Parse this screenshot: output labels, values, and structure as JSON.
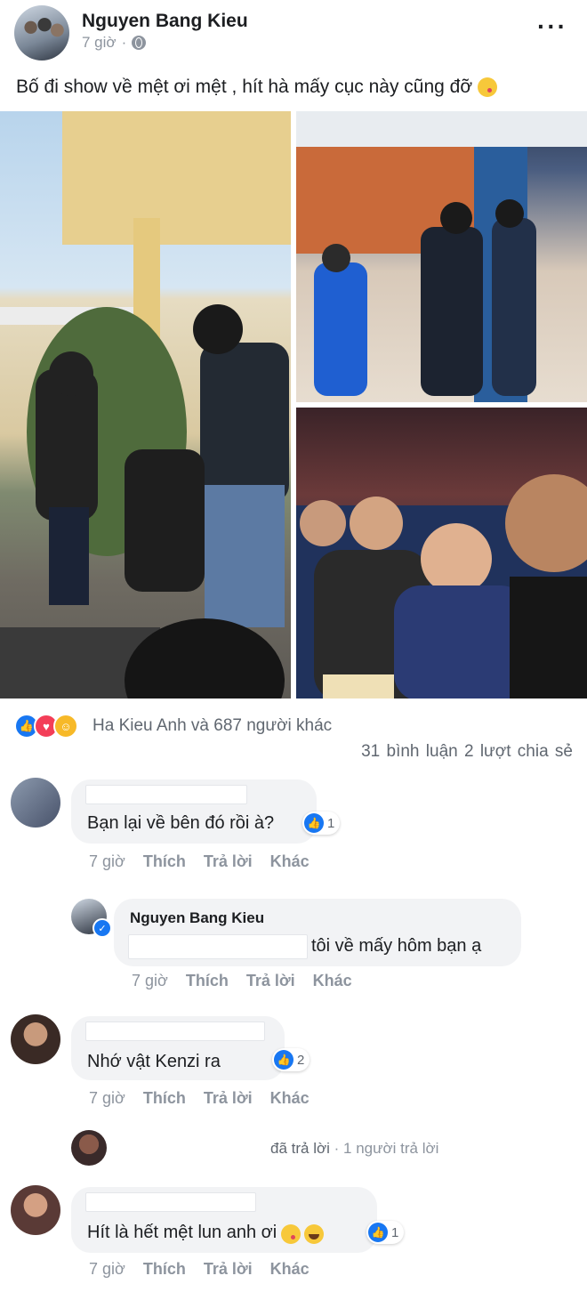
{
  "post": {
    "author": "Nguyen Bang Kieu",
    "time": "7 giờ",
    "caption": "Bố đi show về mệt ơi mệt , hít hà mấy cục này cũng đỡ",
    "more_icon": "ellipsis-icon",
    "privacy_icon": "globe-icon"
  },
  "reactions": {
    "summary": "Ha Kieu Anh và 687 người khác",
    "comments_count": "31 bình luận",
    "shares_count": "2 lượt chia sẻ",
    "icons": [
      "like-icon",
      "love-icon",
      "haha-icon"
    ]
  },
  "actions": {
    "time": "7 giờ",
    "like": "Thích",
    "reply": "Trả lời",
    "more": "Khác"
  },
  "comments": [
    {
      "text": "Bạn lại về bên đó rồi à?",
      "likes": "1"
    },
    {
      "author": "Nguyen Bang Kieu",
      "text": "tôi về mấy hôm bạn ạ"
    },
    {
      "text": "Nhớ vật Kenzi ra",
      "likes": "2"
    },
    {
      "replied": "đã trả lời",
      "reply_count": "· 1 người trả lời"
    },
    {
      "text": "Hít là hết mệt lun anh ơi",
      "likes": "1"
    }
  ],
  "colors": {
    "accent": "#1877f2",
    "love": "#f33e58",
    "haha": "#f7b928",
    "bubble": "#f2f3f5",
    "muted": "#8d949e"
  }
}
